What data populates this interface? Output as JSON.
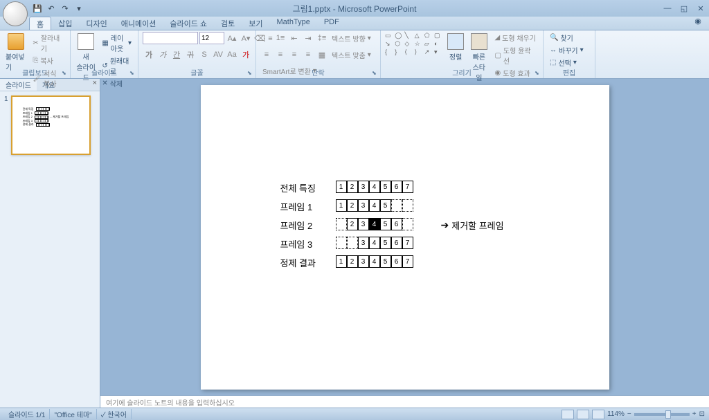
{
  "app": {
    "title": "그림1.pptx - Microsoft PowerPoint"
  },
  "qat": {
    "save": "💾",
    "undo": "↶",
    "redo": "↷"
  },
  "tabs": {
    "home": "홈",
    "insert": "삽입",
    "design": "디자인",
    "animation": "애니메이션",
    "slideshow": "슬라이드 쇼",
    "review": "검토",
    "view": "보기",
    "mathtype": "MathType",
    "pdf": "PDF"
  },
  "ribbon": {
    "clipboard": {
      "label": "클립보드",
      "paste": "붙여넣기",
      "cut": "잘라내기",
      "copy": "복사",
      "format_painter": "서식 복사"
    },
    "slides": {
      "label": "슬라이드",
      "new_slide": "새\n슬라이드",
      "layout": "레이아웃",
      "reset": "원래대로",
      "delete": "삭제"
    },
    "font": {
      "label": "글꼴",
      "size": "12"
    },
    "paragraph": {
      "label": "단락",
      "text_direction": "텍스트 방향",
      "align_text": "텍스트 맞춤",
      "smartart": "SmartArt로 변환"
    },
    "drawing": {
      "label": "그리기",
      "arrange": "정렬",
      "quick_styles": "빠른\n스타일",
      "shape_fill": "도형 채우기",
      "shape_outline": "도형 윤곽선",
      "shape_effects": "도형 효과"
    },
    "editing": {
      "label": "편집",
      "find": "찾기",
      "replace": "바꾸기",
      "select": "선택"
    }
  },
  "outline": {
    "tab_slides": "슬라이드",
    "tab_outline": "개요",
    "slide_num": "1"
  },
  "slide_content": {
    "rows": [
      {
        "label": "전체 특징",
        "cells": [
          1,
          2,
          3,
          4,
          5,
          6,
          7
        ],
        "offset": 0,
        "dotted": []
      },
      {
        "label": "프레임 1",
        "cells": [
          1,
          2,
          3,
          4,
          5
        ],
        "offset": 0,
        "dotted": [
          5,
          6
        ]
      },
      {
        "label": "프레임 2",
        "cells": [
          2,
          3,
          4,
          5,
          6
        ],
        "offset": 1,
        "dotted": [
          0,
          6
        ],
        "black": 4,
        "arrow_text": "제거할 프레임"
      },
      {
        "label": "프레임 3",
        "cells": [
          3,
          4,
          5,
          6,
          7
        ],
        "offset": 2,
        "dotted": [
          0,
          1
        ]
      },
      {
        "label": "정제 결과",
        "cells": [
          1,
          2,
          3,
          4,
          5,
          6,
          7
        ],
        "offset": 0,
        "dotted": [
          3
        ]
      }
    ]
  },
  "notes": {
    "placeholder": "여기에 슬라이드 노트의 내용을 입력하십시오"
  },
  "status": {
    "slide_info": "슬라이드 1/1",
    "theme": "\"Office 테마\"",
    "language": "한국어",
    "zoom": "114%"
  }
}
